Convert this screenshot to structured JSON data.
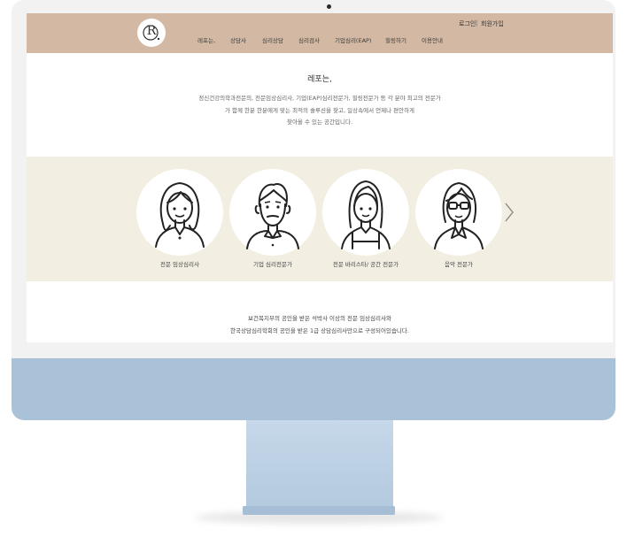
{
  "header": {
    "logo_text": "R",
    "util": {
      "login": "로그인",
      "separator": "|",
      "signup": "회원가입"
    },
    "nav": [
      "레포는,",
      "상담사",
      "심리상담",
      "심리검사",
      "기업심리(EAP)",
      "힐링하기",
      "이용안내"
    ]
  },
  "intro": {
    "title": "레포는,",
    "lines": [
      "정신건강의학과전문의, 전문임상심리사, 기업(EAP)심리전문가, 힐링전문가 등 각 분야 최고의 전문가",
      "가 함께 한분 한분에게 맞는 최적의 솔루션을 찾고, 일상속에서 언제나 편안하게",
      "찾아올 수 있는 공간입니다."
    ]
  },
  "experts": [
    {
      "label": "전문 임상심리사",
      "icon": "woman-avatar-icon"
    },
    {
      "label": "기업 심리전문가",
      "icon": "man-avatar-icon"
    },
    {
      "label": "전문 바리스타/ 공간 전문가",
      "icon": "barista-avatar-icon"
    },
    {
      "label": "음악 전문가",
      "icon": "glasses-woman-avatar-icon"
    }
  ],
  "bottom": {
    "lines": [
      "보건복지부의 공인을 받은 석박사 이상의 전문 임상심리사와",
      "한국상담심리학회의 공인을 받은 1급 상담심리사만으로 구성되어있습니다."
    ]
  },
  "colors": {
    "header_bg": "#d3b9a3",
    "band_bg": "#f3eee2",
    "chin": "#a9c2d8"
  }
}
